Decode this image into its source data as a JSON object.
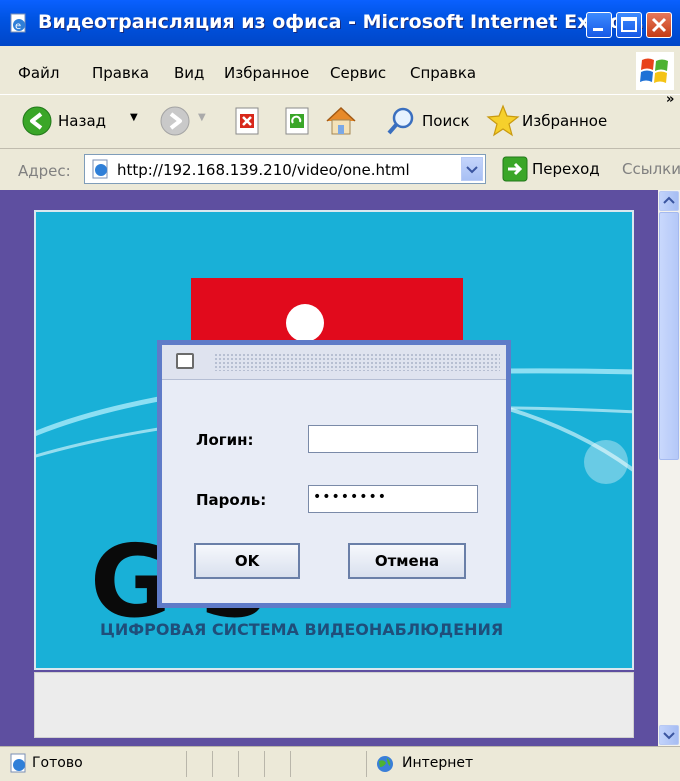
{
  "window": {
    "title": "Видеотрансляция из офиса - Microsoft Internet Explo..."
  },
  "menu": {
    "items": [
      "Файл",
      "Правка",
      "Вид",
      "Избранное",
      "Сервис",
      "Справка"
    ]
  },
  "toolbar": {
    "back_label": "Назад",
    "search_label": "Поиск",
    "favorites_label": "Избранное"
  },
  "address": {
    "label": "Адрес:",
    "url": "http://192.168.139.210/video/one.html",
    "go_label": "Переход",
    "links_label": "Ссылки"
  },
  "page": {
    "logo_text": "G           S",
    "logo_subtitle": "ЦИФРОВАЯ СИСТЕМА ВИДЕОНАБЛЮДЕНИЯ"
  },
  "login_dialog": {
    "login_label": "Логин:",
    "login_value": "",
    "password_label": "Пароль:",
    "password_value": "••••••••",
    "ok_label": "OK",
    "cancel_label": "Отмена"
  },
  "status": {
    "text": "Готово",
    "zone": "Интернет"
  },
  "colors": {
    "titlebar": "#0054e3",
    "page_background": "#5e4fa0",
    "applet_background": "#19b0d7",
    "logo_red": "#e10a1c"
  }
}
